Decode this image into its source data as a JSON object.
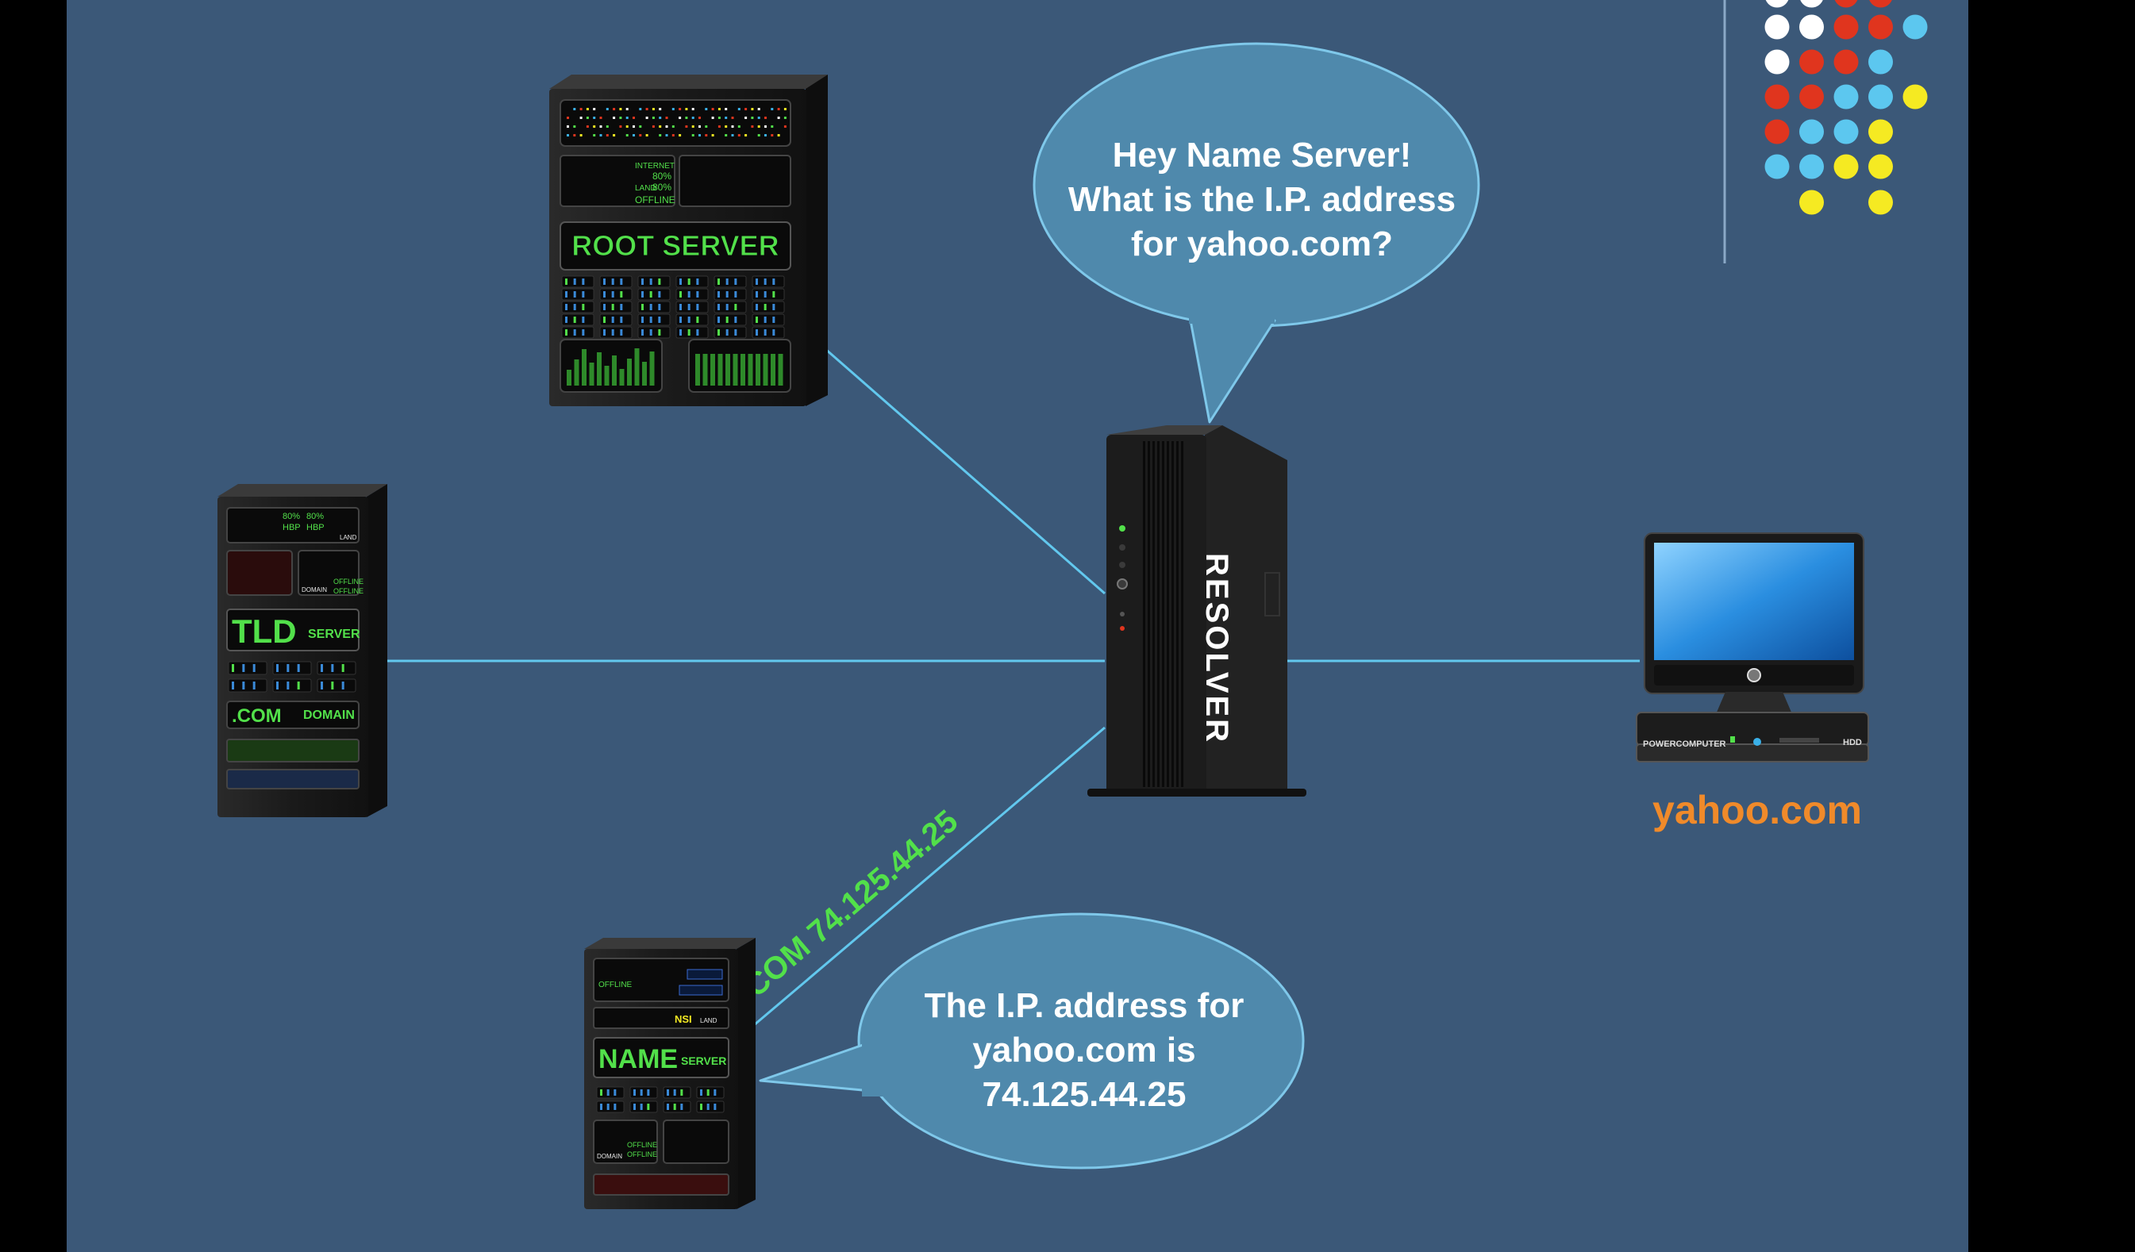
{
  "servers": {
    "root": {
      "label": "ROOT SERVER",
      "panel_texts": [
        "INTERNET",
        "80%",
        "LAND",
        "80%",
        "OFFLINE"
      ]
    },
    "tld": {
      "label": "TLD",
      "sublabel": "SERVER",
      "com_label": ".COM",
      "domain_label": "DOMAIN",
      "panel_texts": [
        "80%",
        "80%",
        "HBP",
        "HBP",
        "LAND",
        "DOMAIN",
        "OFFLINE",
        "OFFLINE"
      ]
    },
    "name": {
      "label": "NAME",
      "sublabel": "SERVER",
      "panel_texts": [
        "OFFLINE",
        "NSI",
        "LAND",
        "DOMAIN",
        "OFFLINE",
        "OFFLINE"
      ]
    },
    "resolver": {
      "label": "RESOLVER"
    }
  },
  "computer": {
    "label": "yahoo.com",
    "brand": "POWERCOMPUTER",
    "badge": "HDD"
  },
  "bubbles": {
    "question": {
      "lines": [
        "Hey Name Server!",
        "What is the I.P. address",
        "for yahoo.com?"
      ]
    },
    "answer": {
      "lines": [
        "The I.P. address for",
        "yahoo.com is",
        "74.125.44.25"
      ]
    }
  },
  "link_label": ".COM 74.125.44.25",
  "colors": {
    "background": "#3b5878",
    "connector": "#62c8ee",
    "bubble_fill": "#4f89ac",
    "bubble_border": "#7fc8ea",
    "green_text": "#52e04a",
    "orange_text": "#f08a2a",
    "dot_white": "#ffffff",
    "dot_red": "#e0351e",
    "dot_blue": "#5cc7ef",
    "dot_yellow": "#f5ea22"
  }
}
